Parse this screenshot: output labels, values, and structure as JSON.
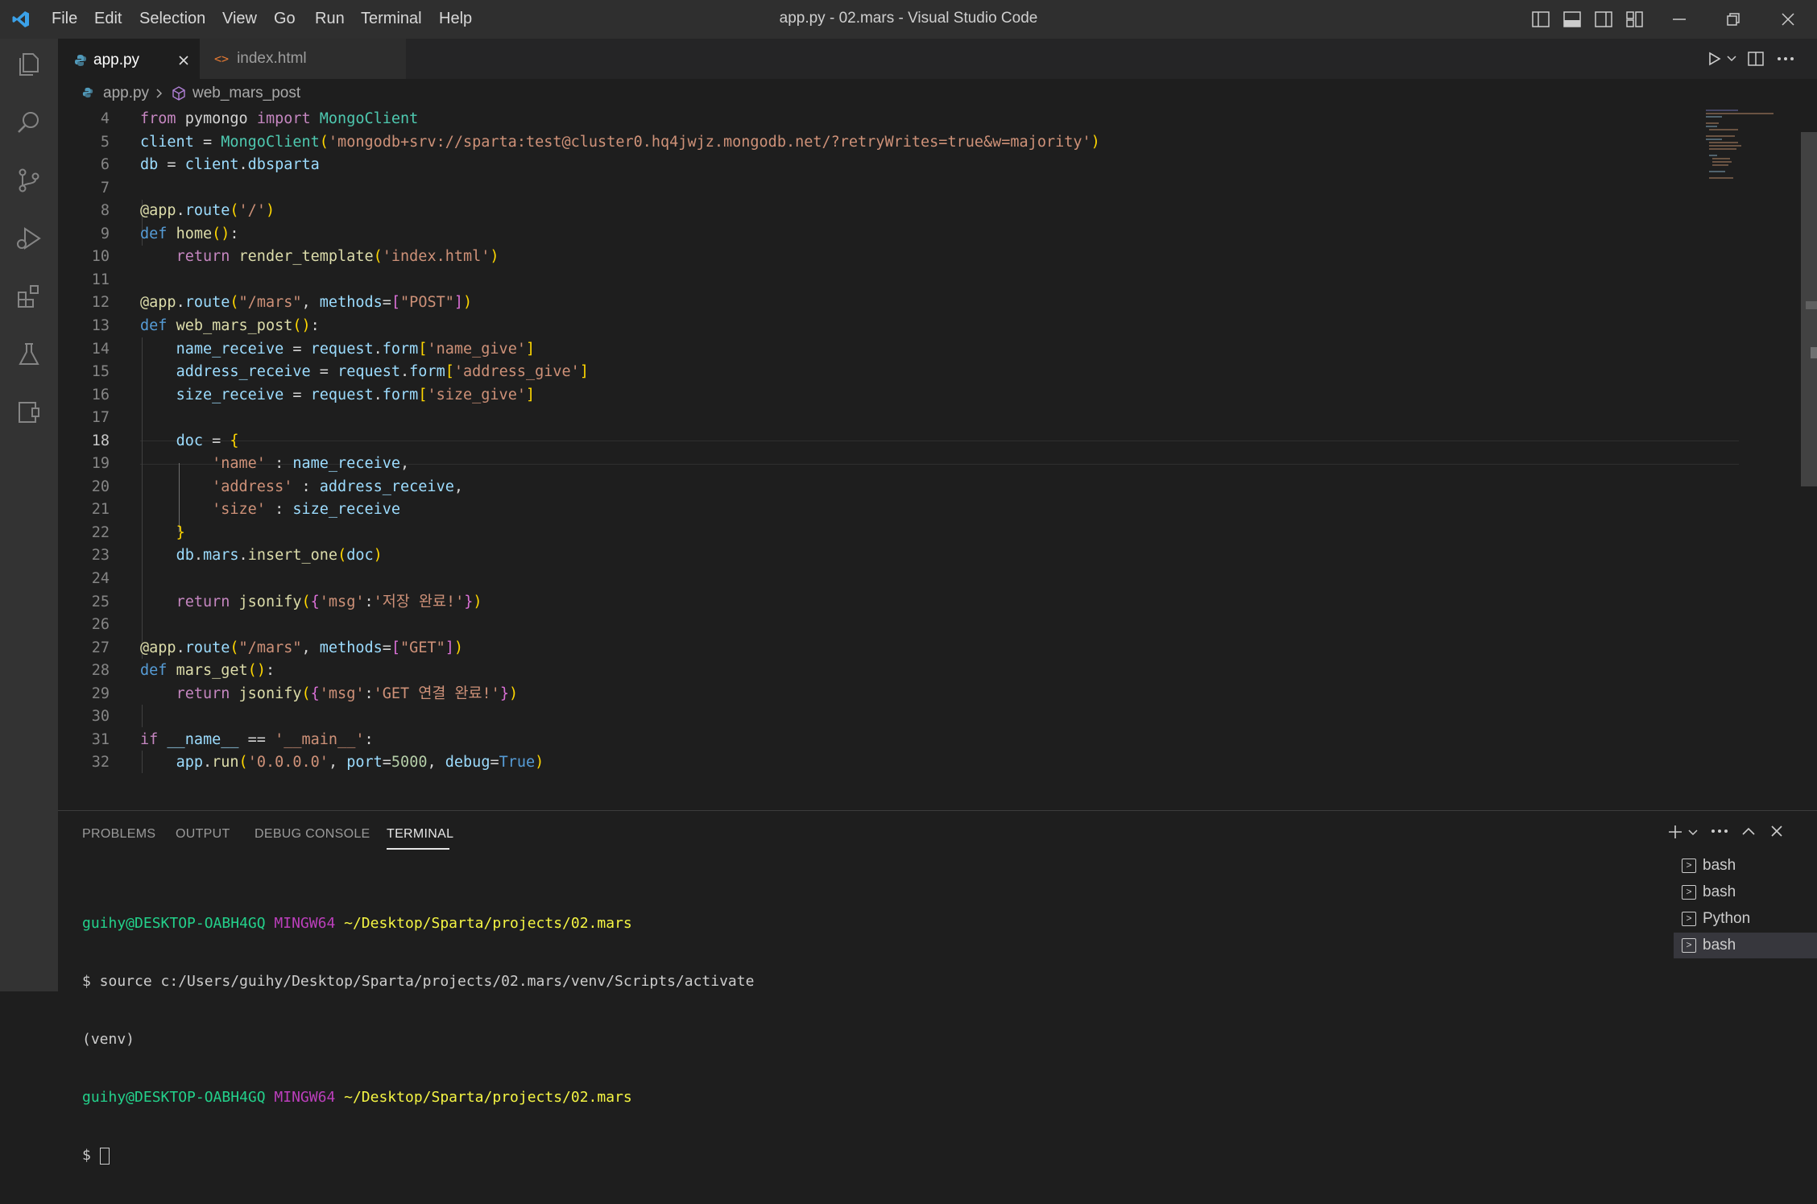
{
  "window": {
    "title": "app.py - 02.mars - Visual Studio Code"
  },
  "menu": [
    "File",
    "Edit",
    "Selection",
    "View",
    "Go",
    "Run",
    "Terminal",
    "Help"
  ],
  "tabs": [
    {
      "label": "app.py",
      "active": true
    },
    {
      "label": "index.html",
      "active": false
    }
  ],
  "breadcrumb": {
    "file": "app.py",
    "symbol": "web_mars_post"
  },
  "editor": {
    "line_numbers": [
      "4",
      "5",
      "6",
      "7",
      "8",
      "9",
      "10",
      "11",
      "12",
      "13",
      "14",
      "15",
      "16",
      "17",
      "18",
      "19",
      "20",
      "21",
      "22",
      "23",
      "24",
      "25",
      "26",
      "27",
      "28",
      "29",
      "30",
      "31",
      "32"
    ],
    "current_line": "18",
    "lines": [
      [
        [
          "k",
          "from"
        ],
        [
          "",
          "  "
        ],
        [
          "",
          "pymongo"
        ],
        [
          "",
          ""
        ],
        [
          "k",
          "import"
        ],
        [
          "",
          ""
        ],
        [
          "c",
          "MongoClient"
        ]
      ],
      [],
      [],
      [],
      [],
      [],
      [],
      [],
      [],
      [],
      [],
      [],
      [],
      [],
      [],
      [],
      [],
      [],
      [],
      [],
      [],
      [],
      [],
      [],
      [],
      [],
      [],
      [],
      []
    ],
    "code": [
      "from pymongo import MongoClient",
      "client = MongoClient('mongodb+srv://sparta:test@cluster0.hq4jwjz.mongodb.net/?retryWrites=true&w=majority')",
      "db = client.dbsparta",
      "",
      "@app.route('/')",
      "def home():",
      "    return render_template('index.html')",
      "",
      "@app.route(\"/mars\", methods=[\"POST\"])",
      "def web_mars_post():",
      "    name_receive = request.form['name_give']",
      "    address_receive = request.form['address_give']",
      "    size_receive = request.form['size_give']",
      "",
      "    doc = {",
      "        'name' : name_receive,",
      "        'address' : address_receive,",
      "        'size' : size_receive",
      "    }",
      "    db.mars.insert_one(doc)",
      "",
      "    return jsonify({'msg':'저장 완료!'})",
      "",
      "@app.route(\"/mars\", methods=[\"GET\"])",
      "def mars_get():",
      "    return jsonify({'msg':'GET 연결 완료!'})",
      "",
      "if __name__ == '__main__':",
      "    app.run('0.0.0.0', port=5000, debug=True)"
    ]
  },
  "panel": {
    "tabs": [
      "PROBLEMS",
      "OUTPUT",
      "DEBUG CONSOLE",
      "TERMINAL"
    ],
    "active_tab": "TERMINAL",
    "terminal": {
      "user_host": "guihy@DESKTOP-OABH4GQ",
      "shell": "MINGW64",
      "path": "~/Desktop/Sparta/projects/02.mars",
      "command": "$ source c:/Users/guihy/Desktop/Sparta/projects/02.mars/venv/Scripts/activate",
      "venv": "(venv)",
      "prompt": "$ "
    },
    "terminal_list": [
      {
        "label": "bash",
        "active": false
      },
      {
        "label": "bash",
        "active": false
      },
      {
        "label": "Python",
        "active": false
      },
      {
        "label": "bash",
        "active": true
      }
    ]
  }
}
